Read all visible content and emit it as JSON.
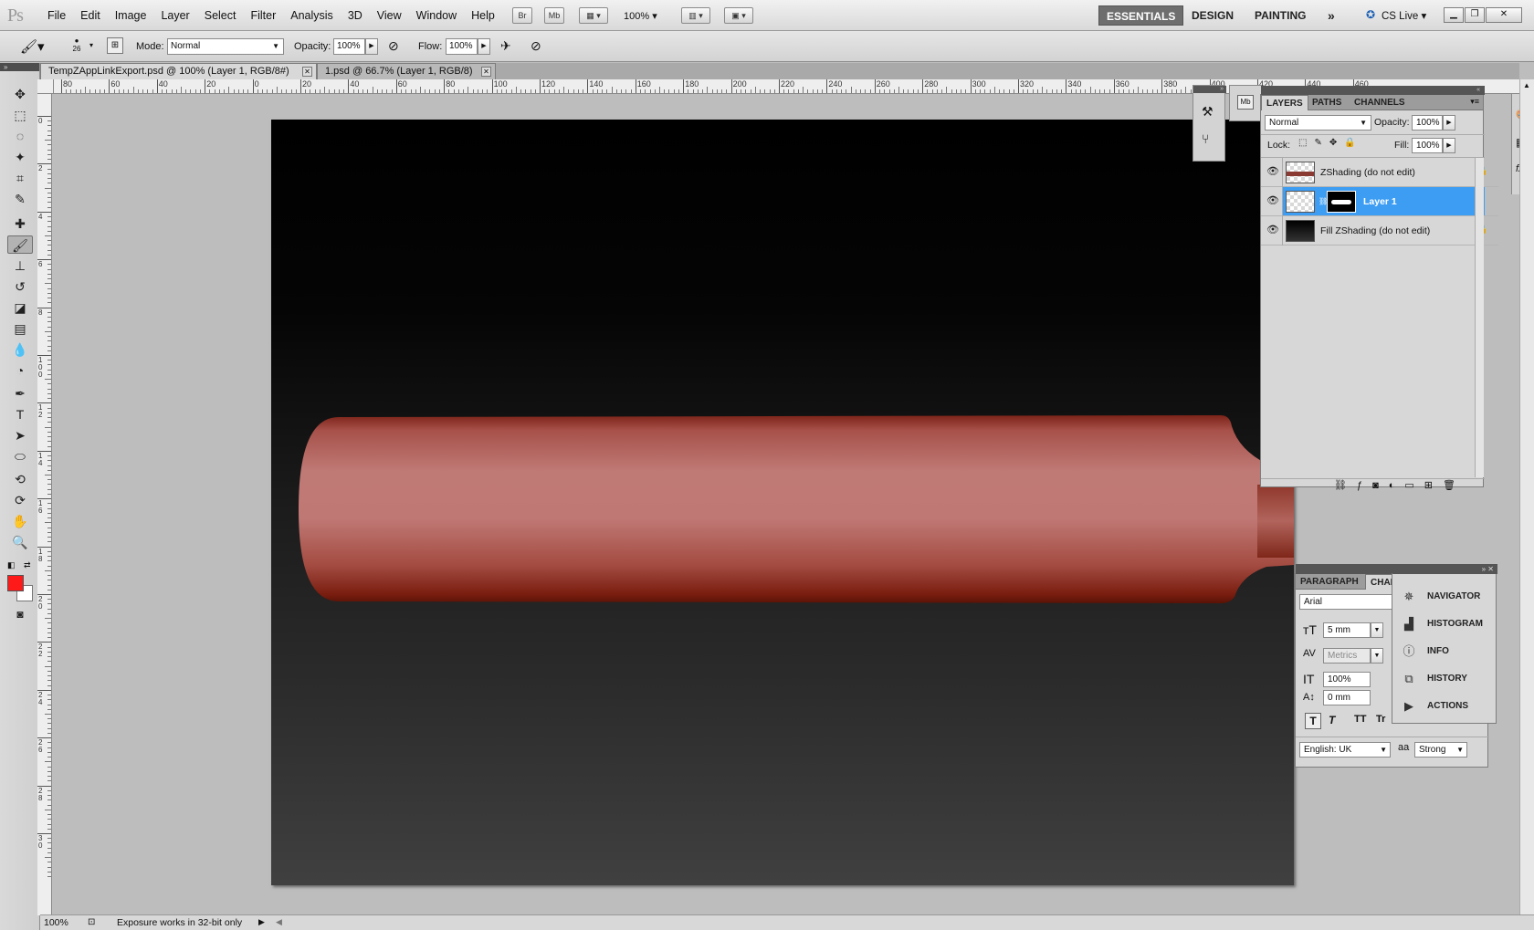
{
  "app": {
    "logo": "Ps"
  },
  "menu": [
    "File",
    "Edit",
    "Image",
    "Layer",
    "Select",
    "Filter",
    "Analysis",
    "3D",
    "View",
    "Window",
    "Help"
  ],
  "appbar": {
    "bridge": "Br",
    "minibridge": "Mb",
    "zoom": "100%"
  },
  "workspaces": {
    "essentials": "ESSENTIALS",
    "design": "DESIGN",
    "painting": "PAINTING",
    "more": "»",
    "cslive": "CS Live"
  },
  "options": {
    "brush_size": "26",
    "mode_label": "Mode:",
    "mode_value": "Normal",
    "opacity_label": "Opacity:",
    "opacity_value": "100%",
    "flow_label": "Flow:",
    "flow_value": "100%"
  },
  "tabs": [
    {
      "label": "TempZAppLinkExport.psd @ 100% (Layer 1, RGB/8#)",
      "active": true
    },
    {
      "label": "1.psd @ 66.7% (Layer 1, RGB/8)",
      "active": false
    }
  ],
  "ruler": {
    "h_ticks": [
      "80",
      "60",
      "40",
      "20",
      "0",
      "20",
      "40",
      "60",
      "80",
      "100",
      "120",
      "140",
      "160",
      "180",
      "200",
      "220",
      "240",
      "260",
      "280",
      "300",
      "320",
      "340",
      "360",
      "380",
      "400",
      "420",
      "440",
      "460"
    ],
    "v_ticks": [
      "0",
      "2",
      "4",
      "6",
      "8",
      "1 0 0",
      "1 2",
      "1 4",
      "1 6",
      "1 8",
      "2 0",
      "2 2",
      "2 4",
      "2 6",
      "2 8",
      "3 0"
    ]
  },
  "status": {
    "zoom": "100%",
    "message": "Exposure works in 32-bit only"
  },
  "layers_panel": {
    "tabs": [
      "LAYERS",
      "PATHS",
      "CHANNELS"
    ],
    "blend_mode": "Normal",
    "opacity_label": "Opacity:",
    "opacity_value": "100%",
    "lock_label": "Lock:",
    "fill_label": "Fill:",
    "fill_value": "100%",
    "layers": [
      {
        "name": "ZShading (do not edit)",
        "locked": true,
        "selected": false
      },
      {
        "name": "Layer 1",
        "locked": false,
        "selected": true
      },
      {
        "name": "Fill ZShading (do not edit)",
        "locked": true,
        "selected": false
      }
    ],
    "selected_color": "#3d9df3"
  },
  "char_panel": {
    "tabs": [
      "PARAGRAPH",
      "CHAR"
    ],
    "font": "Arial",
    "size": "5 mm",
    "kerning": "Metrics",
    "vscale": "100%",
    "baseline": "0 mm",
    "language": "English: UK",
    "antialias": "Strong",
    "aa_icon": "aa",
    "styles": [
      "T",
      "T",
      "TT",
      "Tr"
    ]
  },
  "nav_panel": {
    "items": [
      {
        "label": "NAVIGATOR",
        "icon": "navigator-icon"
      },
      {
        "label": "HISTOGRAM",
        "icon": "histogram-icon"
      },
      {
        "label": "INFO",
        "icon": "info-icon"
      },
      {
        "label": "HISTORY",
        "icon": "history-icon"
      },
      {
        "label": "ACTIONS",
        "icon": "actions-icon"
      }
    ]
  },
  "colors": {
    "foreground": "#ff1a1a",
    "background": "#ffffff",
    "object": "#c37a76"
  }
}
